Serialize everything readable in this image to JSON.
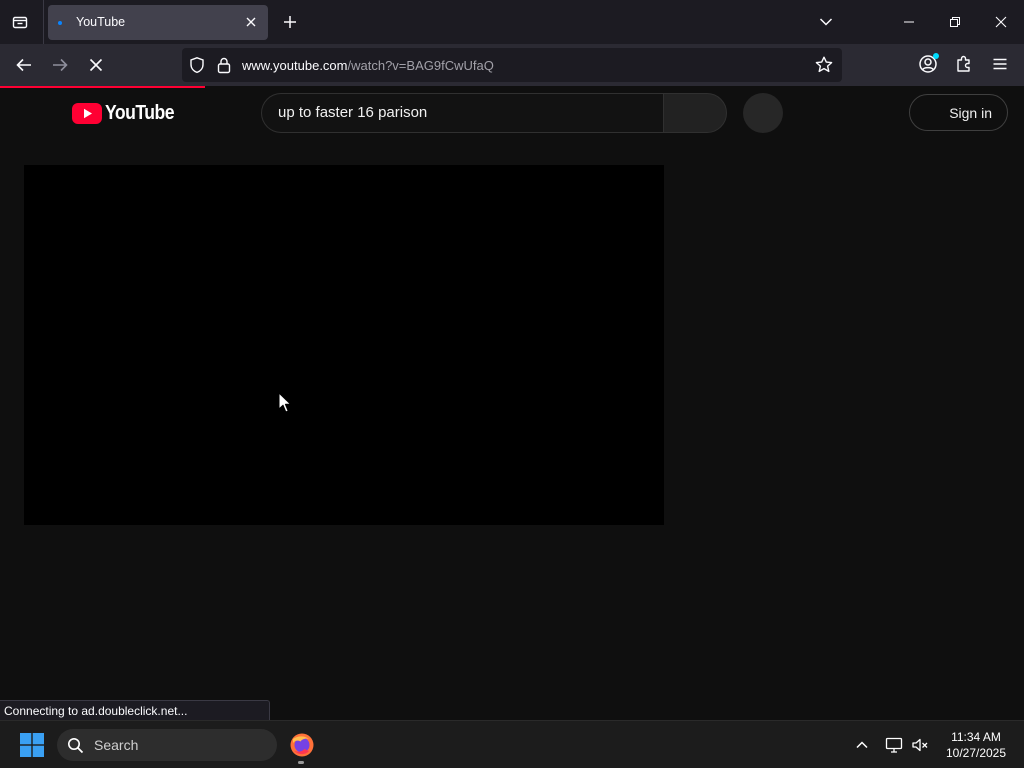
{
  "browser": {
    "tab": {
      "title": "YouTube"
    },
    "url": {
      "host": "www.youtube.com",
      "path": "/watch?v=BAG9fCwUfaQ"
    },
    "status_text": "Connecting to ad.doubleclick.net...",
    "load_progress": 0.2
  },
  "youtube": {
    "logo_text": "YouTube",
    "search_query": "up to faster 16 parison",
    "signin_label": "Sign in"
  },
  "taskbar": {
    "search_label": "Search",
    "time": "11:34 AM",
    "date": "10/27/2025"
  },
  "colors": {
    "youtube_red": "#ff0033",
    "firefox_accent": "#0a84ff",
    "page_background": "#0f0f0f"
  },
  "icons": [
    "tab-list-icon",
    "close-icon",
    "plus-icon",
    "chevron-down-icon",
    "minimize-icon",
    "maximize-icon",
    "back-arrow-icon",
    "forward-arrow-icon",
    "stop-icon",
    "shield-icon",
    "lock-icon",
    "star-icon",
    "account-icon",
    "extensions-icon",
    "hamburger-menu-icon",
    "youtube-play-icon",
    "windows-start-icon",
    "search-icon",
    "firefox-icon",
    "chevron-up-icon",
    "network-icon",
    "volume-muted-icon",
    "mouse-cursor"
  ]
}
